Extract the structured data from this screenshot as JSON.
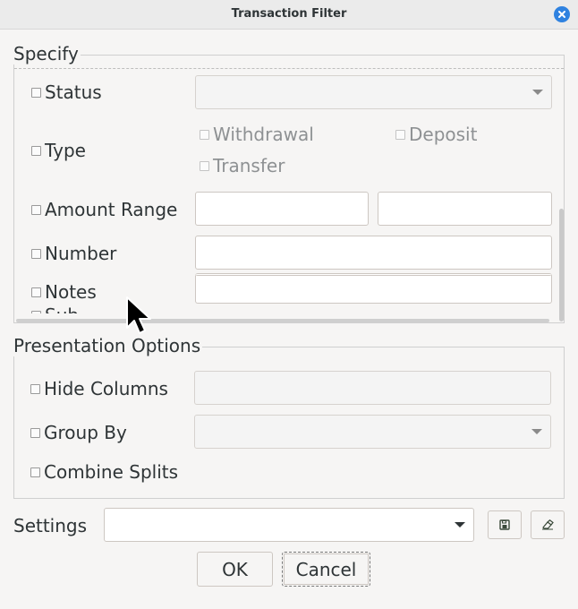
{
  "window": {
    "title": "Transaction Filter"
  },
  "specify": {
    "legend": "Specify",
    "status_label": "Status",
    "type_label": "Type",
    "type_options": [
      "Withdrawal",
      "Deposit",
      "Transfer"
    ],
    "amount_label": "Amount Range",
    "number_label": "Number",
    "notes_label": "Notes",
    "partial_label": "Sub..."
  },
  "presentation": {
    "legend": "Presentation Options",
    "hide_columns_label": "Hide Columns",
    "group_by_label": "Group By",
    "combine_splits_label": "Combine Splits"
  },
  "settings": {
    "label": "Settings"
  },
  "buttons": {
    "ok": "OK",
    "cancel": "Cancel"
  },
  "icons": {
    "close": "close-icon",
    "save": "save-icon",
    "clear": "eraser-icon"
  },
  "colors": {
    "accent": "#2f82e0",
    "background": "#f6f5f4"
  }
}
